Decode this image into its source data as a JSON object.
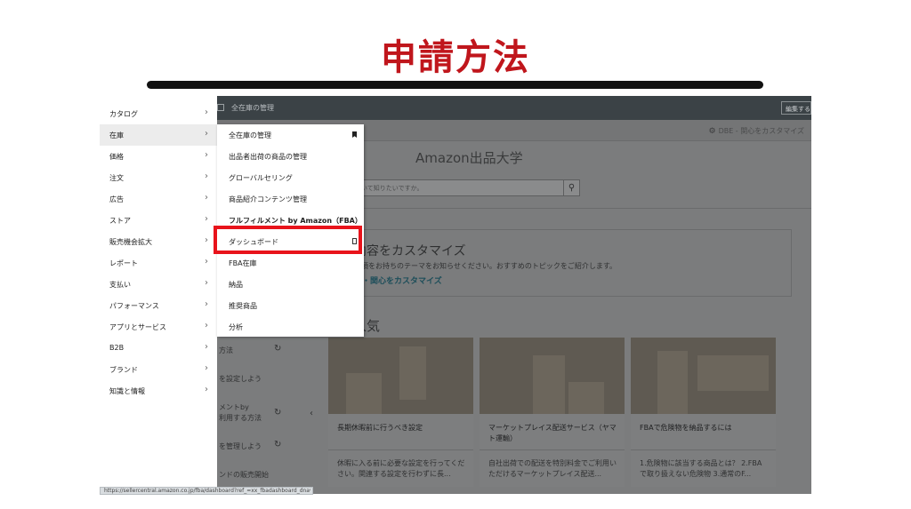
{
  "slide": {
    "title": "申請方法"
  },
  "topbar": {
    "crumb": "全在庫の管理",
    "edit_label": "編集する"
  },
  "subbar": {
    "customize": "DBE - 関心をカスタマイズ"
  },
  "main": {
    "heading": "Amazon出品大学",
    "search_placeholder": "ついて知りたいですか。",
    "custom_heading": "内容をカスタマイズ",
    "custom_text": "事項をお持ちのテーマをお知らせください。おすすめのトピックをご紹介します。",
    "custom_link": "事・関心をカスタマイズ",
    "popular": "人気",
    "left_items": [
      "方法",
      "を設定しよう",
      "メントby",
      "利用する方法",
      "を管理しよう",
      "ンドの販売開始"
    ],
    "cards": [
      {
        "title": "長期休暇前に行うべき設定",
        "desc": "休暇に入る前に必要な設定を行ってください。関連する設定を行わずに長..."
      },
      {
        "title": "マーケットプレイス配送サービス（ヤマト運輸）",
        "desc": "自社出荷での配送を特別料金でご利用いただけるマーケットプレイス配送..."
      },
      {
        "title": "FBAで危険物を納品するには",
        "desc": "1.危険物に該当する商品とは？ 2.FBAで取り扱えない危険物 3.通常のF..."
      }
    ]
  },
  "menu1": [
    {
      "label": "カタログ"
    },
    {
      "label": "在庫"
    },
    {
      "label": "価格"
    },
    {
      "label": "注文"
    },
    {
      "label": "広告"
    },
    {
      "label": "ストア"
    },
    {
      "label": "販売機会拡大"
    },
    {
      "label": "レポート"
    },
    {
      "label": "支払い"
    },
    {
      "label": "パフォーマンス"
    },
    {
      "label": "アプリとサービス"
    },
    {
      "label": "B2B"
    },
    {
      "label": "ブランド"
    },
    {
      "label": "知識と情報"
    }
  ],
  "menu1_chevron": "›",
  "menu2": [
    {
      "label": "全在庫の管理"
    },
    {
      "label": "出品者出荷の商品の管理"
    },
    {
      "label": "グローバルセリング"
    },
    {
      "label": "商品紹介コンテンツ管理"
    },
    {
      "label": "フルフィルメント by Amazon（FBA）"
    },
    {
      "label": "ダッシュボード"
    },
    {
      "label": "FBA在庫"
    },
    {
      "label": "納品"
    },
    {
      "label": "推奨商品"
    },
    {
      "label": "分析"
    }
  ],
  "status_url": "https://sellercentral.amazon.co.jp/fba/dashboard?ref_=xx_fbadashboard_dnav_xx",
  "colors": {
    "title": "#c0161c",
    "highlight": "#e8131b"
  },
  "icons": {
    "gear": "gear-icon",
    "search": "search-icon",
    "pin": "bookmark-icon"
  }
}
